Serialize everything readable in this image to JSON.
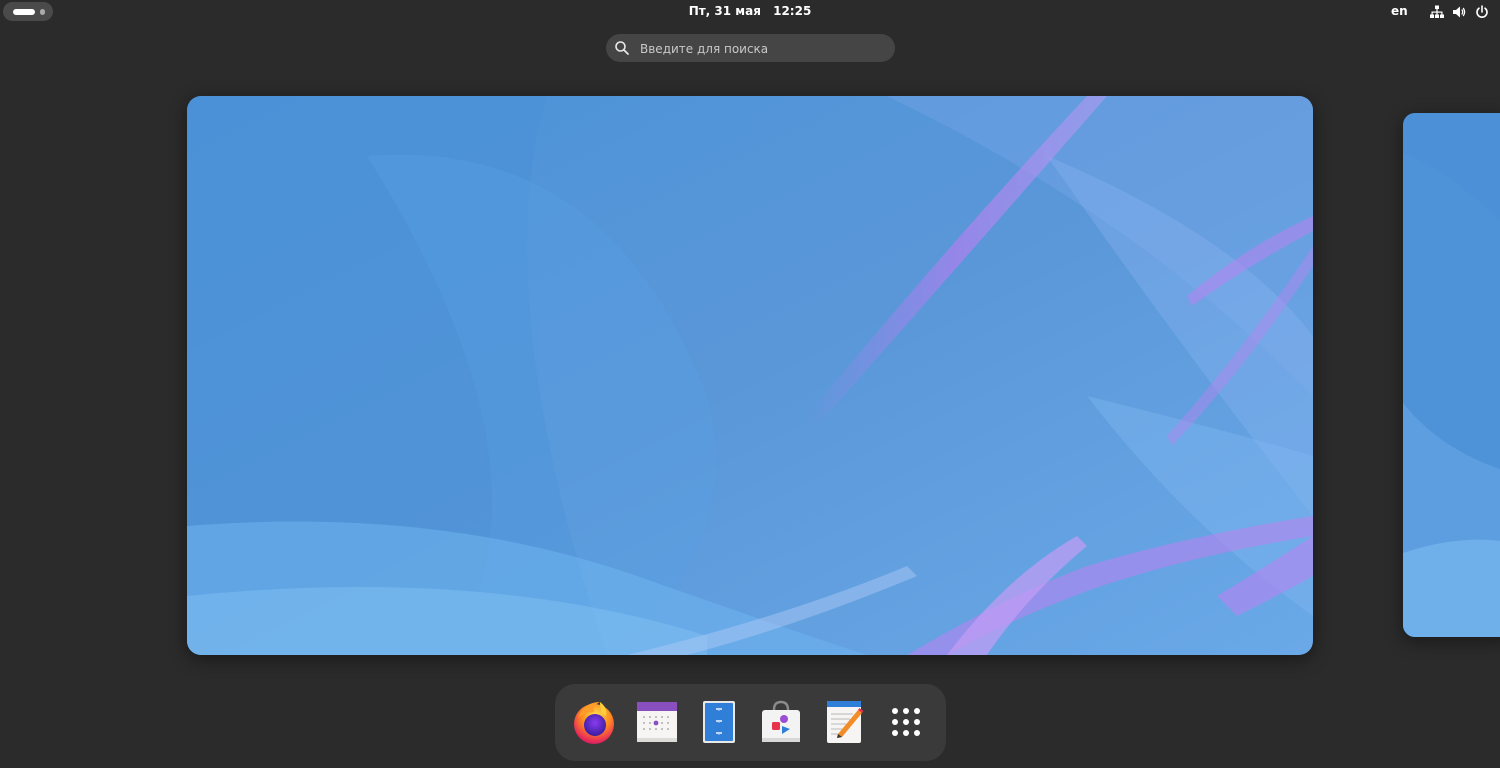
{
  "topbar": {
    "clock_day": "Пт, 31 мая",
    "clock_time": "12:25",
    "language": "en",
    "tray_icons": [
      "network-icon",
      "volume-icon",
      "power-icon"
    ]
  },
  "search": {
    "placeholder": "Введите для поиска",
    "value": ""
  },
  "workspaces": {
    "count_visible": 2
  },
  "dock": {
    "apps": [
      {
        "name": "firefox",
        "icon": "firefox-icon"
      },
      {
        "name": "calendar",
        "icon": "calendar-icon"
      },
      {
        "name": "file-roller",
        "icon": "archive-icon"
      },
      {
        "name": "software",
        "icon": "software-store-icon"
      },
      {
        "name": "text-editor",
        "icon": "text-editor-icon"
      },
      {
        "name": "show-apps",
        "icon": "app-grid-icon"
      }
    ]
  },
  "colors": {
    "shell_bg": "#2b2b2b",
    "dock_bg": "#3a3a3a",
    "wallpaper_blue": "#4f93d9",
    "wallpaper_purple": "#b07ff0"
  }
}
